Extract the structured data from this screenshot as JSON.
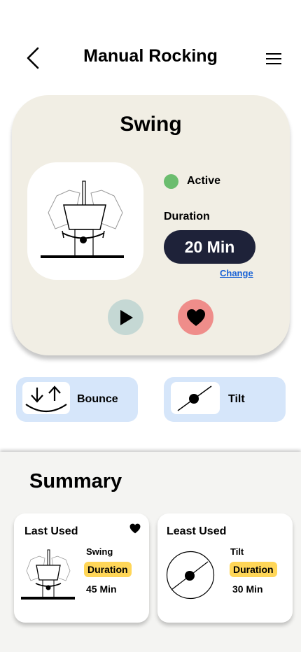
{
  "header": {
    "title": "Manual Rocking",
    "back_icon": "chevron-left-icon",
    "menu_icon": "hamburger-menu-icon"
  },
  "main_card": {
    "title": "Swing",
    "status": {
      "text": "Active",
      "color": "#6bbd6e"
    },
    "duration_label": "Duration",
    "duration_value": "20 Min",
    "change_label": "Change",
    "play_icon": "play-icon",
    "favorite_icon": "heart-icon"
  },
  "modes": [
    {
      "label": "Bounce",
      "icon": "bounce-icon"
    },
    {
      "label": "Tilt",
      "icon": "tilt-icon"
    }
  ],
  "summary": {
    "title": "Summary",
    "last_used": {
      "title": "Last Used",
      "mode": "Swing",
      "badge": "Duration",
      "duration": "45 Min",
      "favorite_icon": "heart-icon"
    },
    "least_used": {
      "title": "Least Used",
      "mode": "Tilt",
      "badge": "Duration",
      "duration": "30 Min"
    }
  },
  "colors": {
    "card_bg": "#f1eee4",
    "pill_bg": "#1e2239",
    "mode_bg": "#d6e6fa",
    "badge_bg": "#ffd658",
    "play_bg": "#c5d8d4",
    "fav_bg": "#ef8d8a",
    "link": "#1a63d6"
  }
}
